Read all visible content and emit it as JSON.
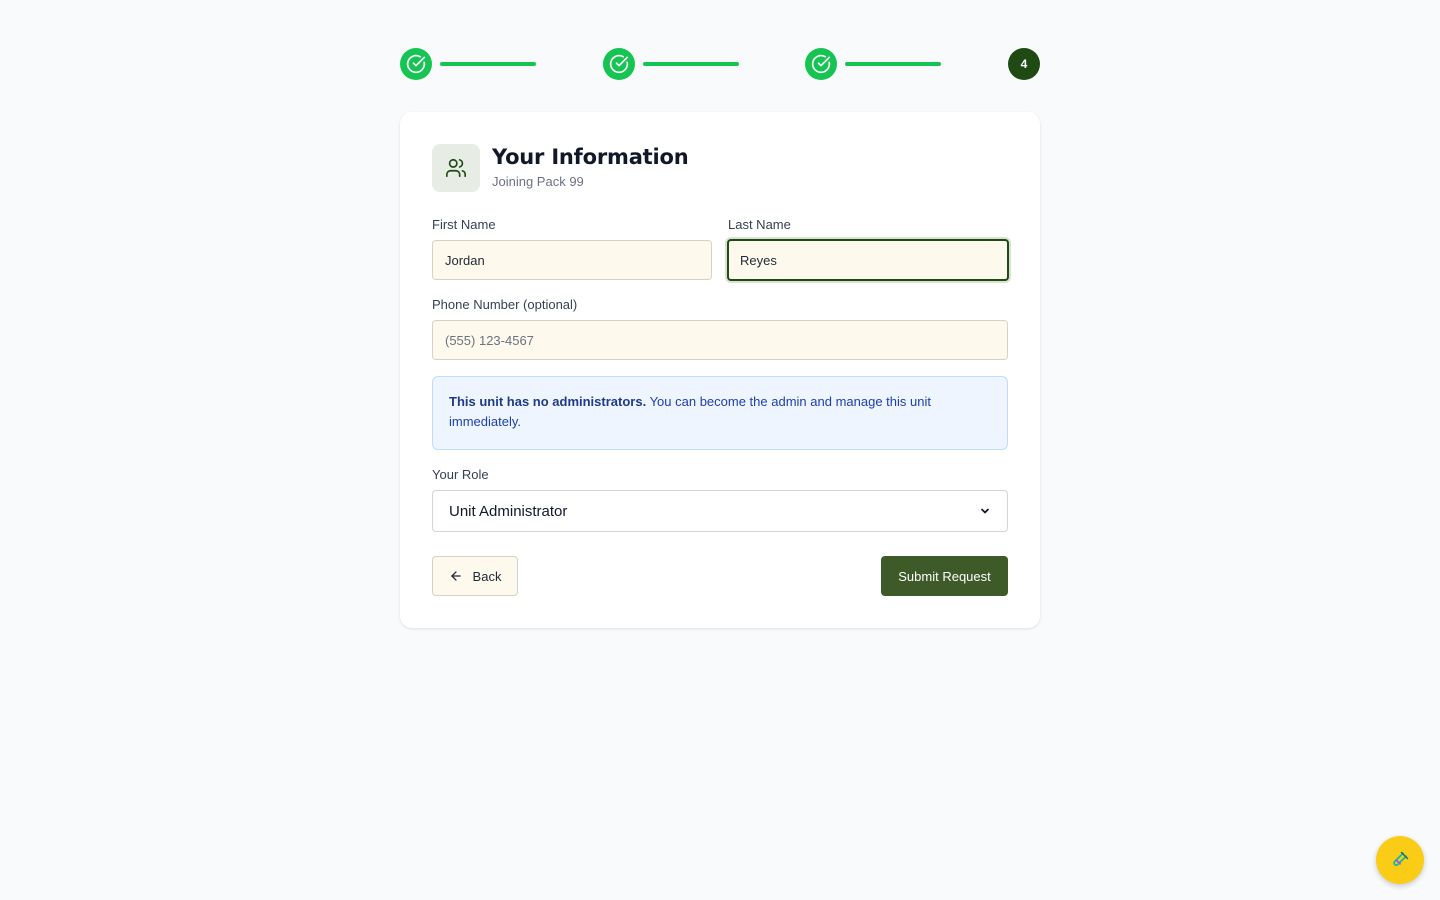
{
  "stepper": {
    "steps": [
      {
        "state": "complete",
        "icon": "check-circle-icon"
      },
      {
        "state": "complete",
        "icon": "check-circle-icon"
      },
      {
        "state": "complete",
        "icon": "check-circle-icon"
      },
      {
        "state": "current",
        "label": "4"
      }
    ],
    "completed_color": "#16c453",
    "current_color": "#1f4a14"
  },
  "card": {
    "icon": "users-icon",
    "title": "Your Information",
    "subtitle": "Joining Pack 99"
  },
  "form": {
    "first_name": {
      "label": "First Name",
      "value": "Jordan"
    },
    "last_name": {
      "label": "Last Name",
      "value": "Reyes"
    },
    "phone": {
      "label": "Phone Number (optional)",
      "placeholder": "(555) 123-4567",
      "value": ""
    },
    "role": {
      "label": "Your Role",
      "selected": "Unit Administrator"
    }
  },
  "notice": {
    "bold": "This unit has no administrators.",
    "text": " You can become the admin and manage this unit immediately."
  },
  "actions": {
    "back_label": "Back",
    "submit_label": "Submit Request"
  },
  "colors": {
    "primary": "#3d5a28",
    "accent_fab": "#facc15",
    "notice_text": "#1e40af"
  },
  "fab": {
    "icon": "test-tube-icon"
  }
}
